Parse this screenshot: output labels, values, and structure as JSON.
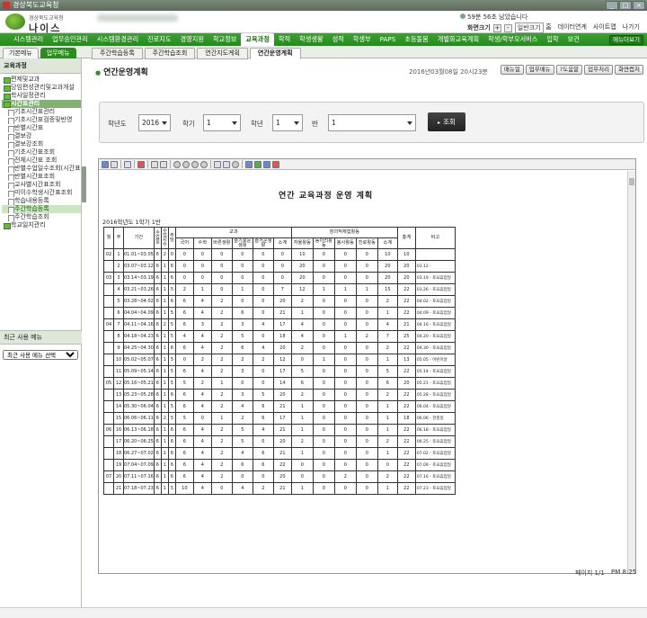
{
  "window": {
    "title": "경상북도교육청"
  },
  "header": {
    "org_label": "경상북도교육청",
    "app_name": "나이스",
    "session_timer": "59분 56초 남았습니다",
    "screen_size_label": "화면크기",
    "zoom_value": "일반크기",
    "zoom_plus": "+",
    "zoom_minus": "-",
    "links": [
      "홈",
      "데이터연계",
      "사이트맵",
      "나가기"
    ]
  },
  "topnav": {
    "items": [
      "시스템관리",
      "업무승인관리",
      "시스템환경관리",
      "진로지도",
      "경영지원",
      "학교정보",
      "교육과정",
      "학적",
      "학생생활",
      "성적",
      "학생부",
      "PAPS",
      "초등돌봄",
      "개별화교육계획",
      "학생/학부모서비스",
      "입학",
      "보건"
    ],
    "active_index": 6,
    "menu_toggle": "메뉴더보기"
  },
  "sidebar": {
    "tabs": [
      "기본메뉴",
      "업무메뉴"
    ],
    "active_tab": 1,
    "heading": "교육과정",
    "tree": [
      {
        "level": 1,
        "label": "편제및교과",
        "selected": false
      },
      {
        "level": 1,
        "label": "당임편성관리및교과개설",
        "selected": false
      },
      {
        "level": 1,
        "label": "학사일정관리",
        "selected": false
      },
      {
        "level": 1,
        "label": "시간표관리",
        "selected": false,
        "open": true
      },
      {
        "level": 2,
        "label": "기초시간표관리",
        "selected": false
      },
      {
        "level": 2,
        "label": "기초시간표검증및반영",
        "selected": false
      },
      {
        "level": 2,
        "label": "반별시간표",
        "selected": false
      },
      {
        "level": 2,
        "label": "결보강",
        "selected": false
      },
      {
        "level": 2,
        "label": "결보강조회",
        "selected": false
      },
      {
        "level": 2,
        "label": "기초시간표조회",
        "selected": false
      },
      {
        "level": 2,
        "label": "전체시간표 조회",
        "selected": false
      },
      {
        "level": 2,
        "label": "반별수업일수조회(시간표)",
        "selected": false
      },
      {
        "level": 2,
        "label": "반별시간표조회",
        "selected": false
      },
      {
        "level": 2,
        "label": "교사별시간표조회",
        "selected": false
      },
      {
        "level": 2,
        "label": "미이수학생시간표조회",
        "selected": false
      },
      {
        "level": 2,
        "label": "학습내용등록",
        "selected": false
      },
      {
        "level": 2,
        "label": "주간학습등록",
        "selected": true
      },
      {
        "level": 2,
        "label": "주간학습조회",
        "selected": false
      },
      {
        "level": 1,
        "label": "학교일지관리",
        "selected": false
      }
    ],
    "recent_heading": "최근 사용 메뉴",
    "recent_select": "최근 사용 메뉴 선택"
  },
  "subtabs": {
    "items": [
      "주간학습등록",
      "주간학습조회",
      "연간지도계획",
      "연간운영계획"
    ],
    "active_index": 3
  },
  "page": {
    "title": "연간운영계획",
    "timestamp": "2016년03월08일 20시23분",
    "actions": [
      "매뉴얼",
      "업무매뉴",
      "?도움말",
      "업무처리",
      "화면캡처"
    ]
  },
  "search": {
    "year_label": "학년도",
    "year_value": "2016",
    "semester_label": "학기",
    "semester_value": "1",
    "grade_label": "학년",
    "grade_value": "1",
    "class_label": "반",
    "class_value": "1",
    "lookup_button": "조회"
  },
  "report": {
    "title": "연간 교육과정 운영 계획",
    "subtitle": "2016학년도 1학기 1반",
    "headers": {
      "month": "월",
      "week": "주",
      "period": "기간",
      "days_a": "수업일",
      "days_b": "수업시수",
      "days_c": "주당",
      "group_subject": "교과",
      "group_creative": "창의적체험활동",
      "total": "총계",
      "note": "비고",
      "sub": [
        "국어",
        "수학",
        "바른생활",
        "슬기로운생활",
        "즐거운생활",
        "소계",
        "자율활동",
        "동아리활동",
        "봉사활동",
        "진로활동",
        "소계"
      ]
    },
    "rows": [
      {
        "m": "02",
        "w": "1",
        "p": "01.01~03.05",
        "d1": "6",
        "d2": "2",
        "d3": "0",
        "c": [
          "0",
          "0",
          "0",
          "0",
          "0",
          "0",
          "10",
          "0",
          "0",
          "0",
          "10"
        ],
        "t": "10",
        "n": ""
      },
      {
        "m": "",
        "w": "2",
        "p": "03.07~03.12",
        "d1": "6",
        "d2": "1",
        "d3": "6",
        "c": [
          "0",
          "0",
          "0",
          "0",
          "0",
          "0",
          "20",
          "0",
          "0",
          "0",
          "20"
        ],
        "t": "20",
        "n": "03.12 -"
      },
      {
        "m": "03",
        "w": "3",
        "p": "03.14~03.19",
        "d1": "6",
        "d2": "1",
        "d3": "6",
        "c": [
          "0",
          "0",
          "0",
          "0",
          "0",
          "0",
          "20",
          "0",
          "0",
          "0",
          "20"
        ],
        "t": "20",
        "n": "03.19 - 토요휴업일"
      },
      {
        "m": "",
        "w": "4",
        "p": "03.21~03.26",
        "d1": "6",
        "d2": "1",
        "d3": "5",
        "c": [
          "2",
          "1",
          "0",
          "1",
          "0",
          "7",
          "12",
          "1",
          "1",
          "1",
          "15"
        ],
        "t": "22",
        "n": "03.26 - 토요휴업일"
      },
      {
        "m": "",
        "w": "5",
        "p": "03.28~04.02",
        "d1": "6",
        "d2": "1",
        "d3": "6",
        "c": [
          "6",
          "4",
          "2",
          "0",
          "0",
          "20",
          "2",
          "0",
          "0",
          "0",
          "2"
        ],
        "t": "22",
        "n": "04.02 - 토요휴업일"
      },
      {
        "m": "",
        "w": "6",
        "p": "04.04~04.09",
        "d1": "6",
        "d2": "1",
        "d3": "5",
        "c": [
          "6",
          "4",
          "2",
          "6",
          "0",
          "21",
          "1",
          "0",
          "0",
          "0",
          "1"
        ],
        "t": "22",
        "n": "04.09 - 토요휴업일"
      },
      {
        "m": "04",
        "w": "7",
        "p": "04.11~04.16",
        "d1": "6",
        "d2": "2",
        "d3": "5",
        "c": [
          "6",
          "3",
          "2",
          "3",
          "4",
          "17",
          "4",
          "0",
          "0",
          "0",
          "4"
        ],
        "t": "21",
        "n": "04.16 - 토요휴업일"
      },
      {
        "m": "",
        "w": "8",
        "p": "04.18~04.23",
        "d1": "6",
        "d2": "1",
        "d3": "5",
        "c": [
          "4",
          "4",
          "2",
          "5",
          "0",
          "18",
          "4",
          "0",
          "1",
          "2",
          "7"
        ],
        "t": "25",
        "n": "04.20 - 토요휴업일"
      },
      {
        "m": "",
        "w": "9",
        "p": "04.25~04.30",
        "d1": "6",
        "d2": "1",
        "d3": "6",
        "c": [
          "6",
          "4",
          "2",
          "6",
          "4",
          "20",
          "2",
          "0",
          "0",
          "0",
          "2"
        ],
        "t": "22",
        "n": "04.30 - 토요휴업일"
      },
      {
        "m": "",
        "w": "10",
        "p": "05.02~05.07",
        "d1": "6",
        "d2": "1",
        "d3": "5",
        "c": [
          "0",
          "2",
          "2",
          "2",
          "2",
          "12",
          "0",
          "1",
          "0",
          "0",
          "1"
        ],
        "t": "13",
        "n": "05.05 - 어린이날"
      },
      {
        "m": "",
        "w": "11",
        "p": "05.09~05.14",
        "d1": "6",
        "d2": "1",
        "d3": "5",
        "c": [
          "6",
          "4",
          "2",
          "3",
          "0",
          "17",
          "5",
          "0",
          "0",
          "0",
          "5"
        ],
        "t": "22",
        "n": "05.14 - 토요휴업일"
      },
      {
        "m": "05",
        "w": "12",
        "p": "05.16~05.21",
        "d1": "6",
        "d2": "1",
        "d3": "5",
        "c": [
          "5",
          "2",
          "1",
          "0",
          "0",
          "14",
          "6",
          "0",
          "0",
          "0",
          "6"
        ],
        "t": "20",
        "n": "05.21 - 토요휴업일"
      },
      {
        "m": "",
        "w": "13",
        "p": "05.23~05.28",
        "d1": "6",
        "d2": "1",
        "d3": "6",
        "c": [
          "6",
          "4",
          "2",
          "3",
          "5",
          "20",
          "2",
          "0",
          "0",
          "0",
          "2"
        ],
        "t": "22",
        "n": "05.28 - 토요휴업일"
      },
      {
        "m": "",
        "w": "14",
        "p": "05.30~06.04",
        "d1": "6",
        "d2": "1",
        "d3": "5",
        "c": [
          "6",
          "4",
          "2",
          "4",
          "6",
          "21",
          "1",
          "0",
          "0",
          "0",
          "1"
        ],
        "t": "22",
        "n": "06.04 - 토요휴업일"
      },
      {
        "m": "",
        "w": "15",
        "p": "06.06~06.11",
        "d1": "6",
        "d2": "2",
        "d3": "5",
        "c": [
          "5",
          "0",
          "1",
          "2",
          "6",
          "17",
          "1",
          "0",
          "0",
          "0",
          "1"
        ],
        "t": "18",
        "n": "06.06 - 현충일"
      },
      {
        "m": "06",
        "w": "16",
        "p": "06.13~06.18",
        "d1": "6",
        "d2": "1",
        "d3": "6",
        "c": [
          "6",
          "4",
          "2",
          "5",
          "4",
          "21",
          "1",
          "0",
          "0",
          "0",
          "1"
        ],
        "t": "22",
        "n": "06.18 - 토요휴업일"
      },
      {
        "m": "",
        "w": "17",
        "p": "06.20~06.25",
        "d1": "6",
        "d2": "1",
        "d3": "6",
        "c": [
          "6",
          "4",
          "2",
          "5",
          "0",
          "20",
          "2",
          "0",
          "0",
          "0",
          "2"
        ],
        "t": "22",
        "n": "06.25 - 토요휴업일"
      },
      {
        "m": "",
        "w": "18",
        "p": "06.27~07.02",
        "d1": "6",
        "d2": "1",
        "d3": "6",
        "c": [
          "6",
          "4",
          "2",
          "4",
          "6",
          "21",
          "1",
          "0",
          "0",
          "0",
          "1"
        ],
        "t": "22",
        "n": "07.02 - 토요휴업일"
      },
      {
        "m": "",
        "w": "19",
        "p": "07.04~07.09",
        "d1": "6",
        "d2": "1",
        "d3": "6",
        "c": [
          "6",
          "4",
          "2",
          "6",
          "6",
          "22",
          "0",
          "0",
          "0",
          "0",
          "0"
        ],
        "t": "22",
        "n": "07.09 - 토요휴업일"
      },
      {
        "m": "07",
        "w": "20",
        "p": "07.11~07.16",
        "d1": "6",
        "d2": "1",
        "d3": "6",
        "c": [
          "6",
          "4",
          "2",
          "0",
          "0",
          "20",
          "0",
          "0",
          "2",
          "0",
          "2"
        ],
        "t": "22",
        "n": "07.16 - 토요휴업일"
      },
      {
        "m": "",
        "w": "21",
        "p": "07.18~07.23",
        "d1": "6",
        "d2": "1",
        "d3": "5",
        "c": [
          "10",
          "4",
          "0",
          "4",
          "2",
          "21",
          "1",
          "0",
          "0",
          "0",
          "1"
        ],
        "t": "22",
        "n": "07.23 - 토요휴업일"
      }
    ]
  },
  "status": {
    "page": "페이지 1/1",
    "time": "PM 8:25"
  }
}
